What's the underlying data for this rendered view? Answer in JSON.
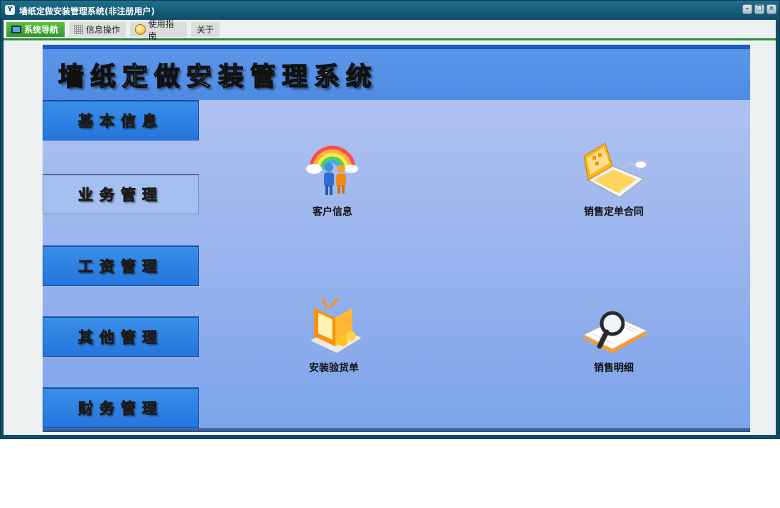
{
  "window": {
    "title": "墙纸定做安装管理系统(非注册用户)",
    "controls": [
      "minimize-icon",
      "restore-icon",
      "close-icon"
    ]
  },
  "menus": [
    {
      "label": "系统导航",
      "icon": "monitor-icon",
      "active": true
    },
    {
      "label": "信息操作",
      "icon": "grid-icon",
      "active": false
    },
    {
      "label": "使用指南",
      "icon": "smiley-icon",
      "active": false
    },
    {
      "label": "关于",
      "icon": "",
      "active": false
    }
  ],
  "banner": {
    "title": "墙纸定做安装管理系统"
  },
  "nav": [
    {
      "label": "基本信息",
      "selected": false
    },
    {
      "label": "业务管理",
      "selected": true
    },
    {
      "label": "工资管理",
      "selected": false
    },
    {
      "label": "其他管理",
      "selected": false
    },
    {
      "label": "财务管理",
      "selected": false
    }
  ],
  "features": [
    {
      "label": "客户信息",
      "icon": "customers-rainbow-icon"
    },
    {
      "label": "销售定单合同",
      "icon": "laptop-icon"
    },
    {
      "label": "安装验货单",
      "icon": "tv-shopping-icon"
    },
    {
      "label": "销售明细",
      "icon": "magnifier-book-icon"
    }
  ],
  "colors": {
    "titlebar": "#0f4d66",
    "accent_green": "#2f8a3a",
    "nav_blue": "#2b7ee3",
    "panel_blue": "#9fb7ee"
  }
}
